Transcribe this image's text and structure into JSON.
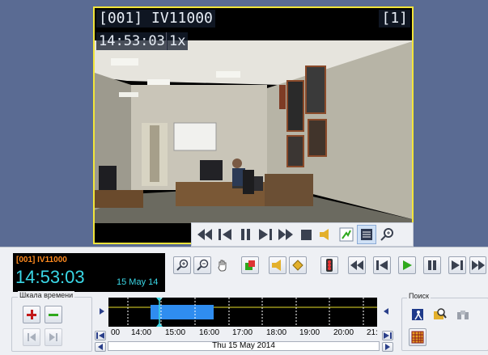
{
  "video": {
    "camera_title": "[001] IV11000",
    "camera_number": "[1]",
    "overlay_time": "14:53:03",
    "overlay_speed": "1x"
  },
  "video_toolbar": {
    "buttons": [
      "rewind-icon",
      "step-back-icon",
      "pause-icon",
      "step-forward-icon",
      "fast-forward-icon",
      "stop-icon",
      "sound-icon",
      "motion-detect-icon",
      "list-icon",
      "zoom-icon"
    ]
  },
  "time_display": {
    "camera": "[001] IV11000",
    "time": "14:53:03",
    "date": "15 May 14"
  },
  "timescale": {
    "label": "Шкала времени",
    "ticks": [
      "00",
      "14:00",
      "15:00",
      "16:00",
      "17:00",
      "18:00",
      "19:00",
      "20:00",
      "21:"
    ],
    "date_label": "Thu 15 May 2014"
  },
  "search": {
    "label": "Поиск"
  },
  "colors": {
    "accent_frame": "#f2e53a",
    "time_cyan": "#3ad7e6",
    "camera_orange": "#ff8a1e",
    "timeline_bar": "#2f8df0",
    "play_green": "#2ea81c"
  }
}
